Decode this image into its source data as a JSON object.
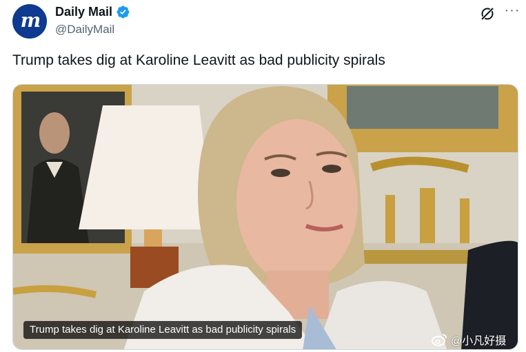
{
  "author": {
    "avatar_letter": "m",
    "display_name": "Daily Mail",
    "handle": "@DailyMail",
    "verified": true
  },
  "actions": {
    "grok_icon": "grok-icon",
    "more_icon": "more-options-icon",
    "more_label": "···"
  },
  "tweet": {
    "text": "Trump takes dig at Karoline Leavitt as bad publicity spirals"
  },
  "media": {
    "caption": "Trump takes dig at Karoline Leavitt as bad publicity spirals"
  },
  "watermark": {
    "text": "@小凡好摄"
  },
  "colors": {
    "avatar_bg": "#0e3a8f",
    "verified_blue": "#1d9bf0",
    "secondary_text": "#536471"
  }
}
